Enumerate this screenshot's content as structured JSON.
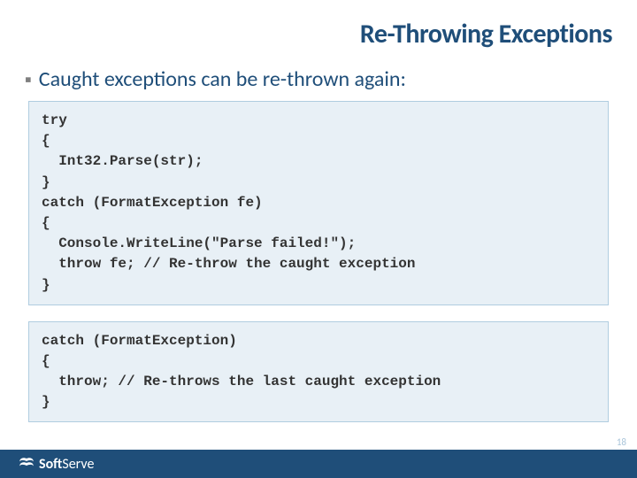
{
  "slide": {
    "title": "Re-Throwing Exceptions",
    "bullet_text": "Caught exceptions can be re-thrown again:",
    "code_block_1": "try\n{\n  Int32.Parse(str);\n}\ncatch (FormatException fe)\n{\n  Console.WriteLine(\"Parse failed!\");\n  throw fe; // Re-throw the caught exception\n}",
    "code_block_2": "catch (FormatException)\n{\n  throw; // Re-throws the last caught exception\n}",
    "page_number": "18"
  },
  "footer": {
    "logo_prefix": "Soft",
    "logo_suffix": "Serve"
  }
}
